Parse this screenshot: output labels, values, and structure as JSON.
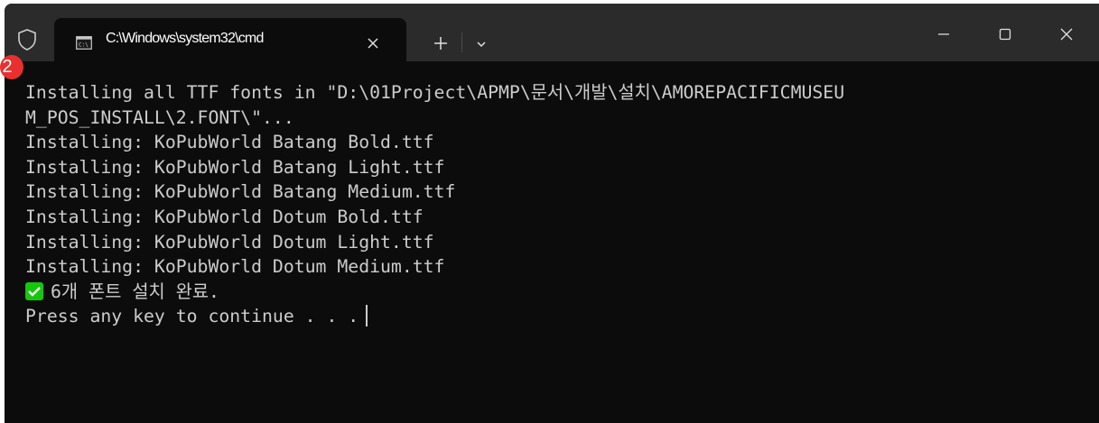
{
  "window": {
    "tab_title": "C:\\Windows\\system32\\cmd",
    "new_tab_label": "+",
    "badge_number": "2",
    "icons": {
      "shield": "shield-icon",
      "tab": "cmd-icon",
      "close_tab": "close-icon",
      "new_tab": "plus-icon",
      "dropdown": "chevron-down-icon",
      "minimize": "minimize-icon",
      "maximize": "maximize-icon",
      "close_window": "close-icon"
    },
    "colors": {
      "titlebar": "#2b2b2b",
      "terminal_bg": "#0c0c0c",
      "terminal_text": "#cccccc",
      "badge": "#e8302e",
      "check": "#16c60c"
    }
  },
  "terminal": {
    "lines": [
      "Installing all TTF fonts in \"D:\\01Project\\APMP\\문서\\개발\\설치\\AMOREPACIFICMUSEU",
      "M_POS_INSTALL\\2.FONT\\\"...",
      "Installing: KoPubWorld Batang Bold.ttf",
      "Installing: KoPubWorld Batang Light.ttf",
      "Installing: KoPubWorld Batang Medium.ttf",
      "Installing: KoPubWorld Dotum Bold.ttf",
      "Installing: KoPubWorld Dotum Light.ttf",
      "Installing: KoPubWorld Dotum Medium.ttf"
    ],
    "done_message": "6개 폰트 설치 완료.",
    "prompt": "Press any key to continue . . ."
  }
}
